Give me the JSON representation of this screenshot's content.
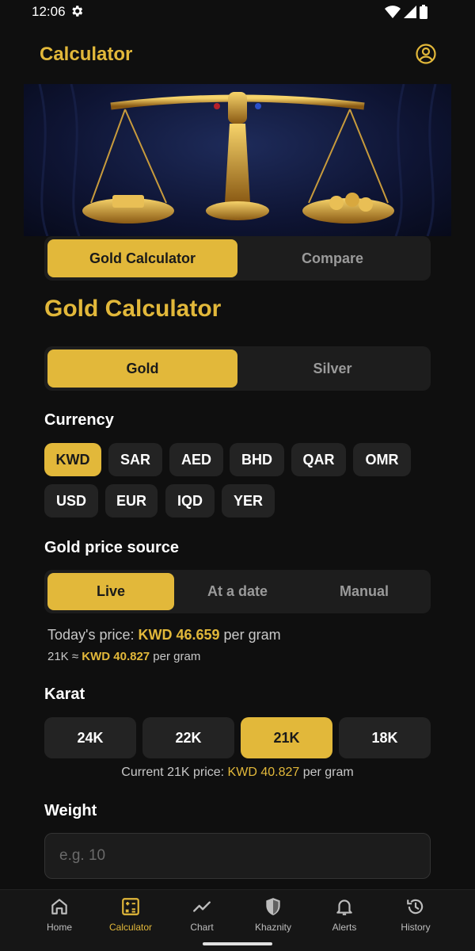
{
  "status": {
    "time": "12:06"
  },
  "app": {
    "title": "Calculator"
  },
  "mode_tabs": [
    {
      "label": "Gold Calculator"
    },
    {
      "label": "Compare"
    }
  ],
  "section": {
    "title": "Gold Calculator"
  },
  "metal_tabs": [
    {
      "label": "Gold"
    },
    {
      "label": "Silver"
    }
  ],
  "currency": {
    "label": "Currency",
    "selected": "KWD",
    "options": [
      "KWD",
      "SAR",
      "AED",
      "BHD",
      "QAR",
      "OMR",
      "USD",
      "EUR",
      "IQD",
      "YER"
    ]
  },
  "price_source": {
    "label": "Gold price source",
    "options": [
      "Live",
      "At a date",
      "Manual"
    ],
    "selected": "Live"
  },
  "prices": {
    "today_prefix": "Today's price: ",
    "today_value": "KWD 46.659",
    "today_suffix": " per gram",
    "karat_prefix": "21K ≈ ",
    "karat_value": "KWD 40.827",
    "karat_suffix": " per gram"
  },
  "karat": {
    "label": "Karat",
    "options": [
      "24K",
      "22K",
      "21K",
      "18K"
    ],
    "selected": "21K",
    "note_prefix": "Current 21K price: ",
    "note_value": "KWD 40.827",
    "note_suffix": " per gram"
  },
  "weight": {
    "label": "Weight",
    "placeholder": "e.g. 10",
    "value": ""
  },
  "nav": {
    "items": [
      {
        "label": "Home",
        "icon": "home-icon"
      },
      {
        "label": "Calculator",
        "icon": "calculator-icon"
      },
      {
        "label": "Chart",
        "icon": "chart-icon"
      },
      {
        "label": "Khaznity",
        "icon": "shield-icon"
      },
      {
        "label": "Alerts",
        "icon": "bell-icon"
      },
      {
        "label": "History",
        "icon": "history-icon"
      }
    ],
    "active": "Calculator"
  },
  "colors": {
    "accent": "#e2b83a",
    "background": "#0f0f0f",
    "surface": "#1d1d1d"
  }
}
